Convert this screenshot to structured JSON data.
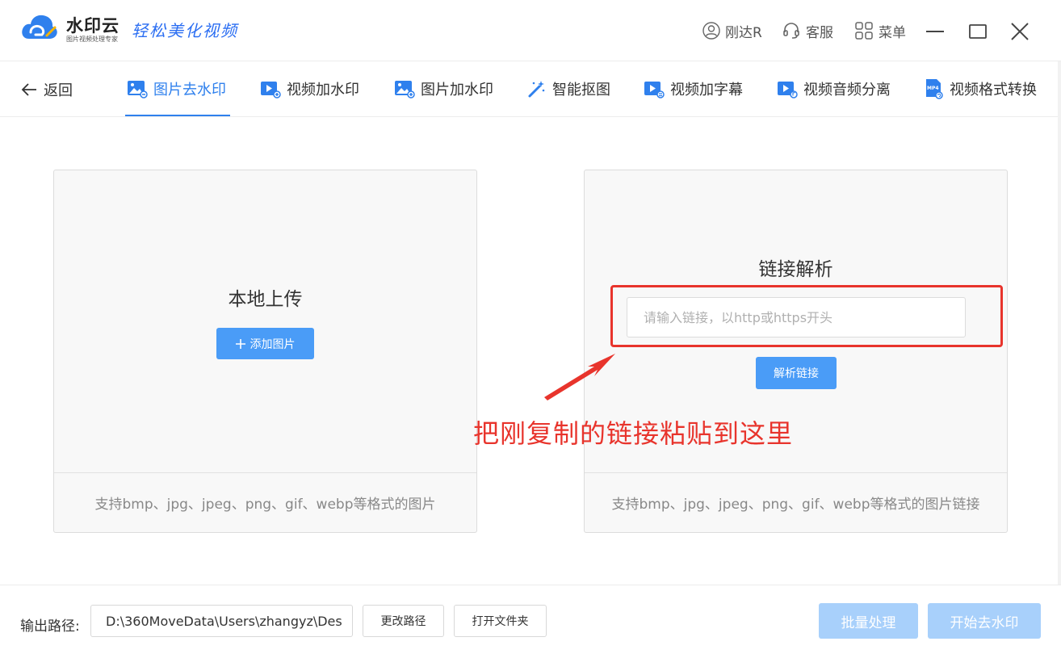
{
  "app": {
    "brand_name": "水印云",
    "brand_sub": "图片视频处理专家",
    "slogan": "轻松美化视频",
    "user_name": "刚达R",
    "service_label": "客服",
    "menu_label": "菜单"
  },
  "nav": {
    "back_label": "返回",
    "tabs": [
      {
        "label": "图片去水印",
        "active": true
      },
      {
        "label": "视频加水印",
        "active": false
      },
      {
        "label": "图片加水印",
        "active": false
      },
      {
        "label": "智能抠图",
        "active": false
      },
      {
        "label": "视频加字幕",
        "active": false
      },
      {
        "label": "视频音频分离",
        "active": false
      },
      {
        "label": "视频格式转换",
        "active": false
      }
    ],
    "mp4_badge": "MP4"
  },
  "local_upload": {
    "title": "本地上传",
    "button_label": "添加图片",
    "footer": "支持bmp、jpg、jpeg、png、gif、webp等格式的图片"
  },
  "link_parse": {
    "title": "链接解析",
    "input_value": "",
    "input_placeholder": "请输入链接，以http或https开头",
    "button_label": "解析链接",
    "footer": "支持bmp、jpg、jpeg、png、gif、webp等格式的图片链接"
  },
  "annotation": {
    "text": "把刚复制的链接粘贴到这里",
    "color": "#e8342c"
  },
  "bottom": {
    "output_label": "输出路径:",
    "output_path": "D:\\360MoveData\\Users\\zhangyz\\Des",
    "change_path_label": "更改路径",
    "open_folder_label": "打开文件夹",
    "batch_label": "批量处理",
    "start_label": "开始去水印"
  },
  "colors": {
    "accent": "#2f80ed",
    "button": "#4a9cf7",
    "button_disabled": "#a8d0fb",
    "annotation_red": "#e8342c"
  }
}
